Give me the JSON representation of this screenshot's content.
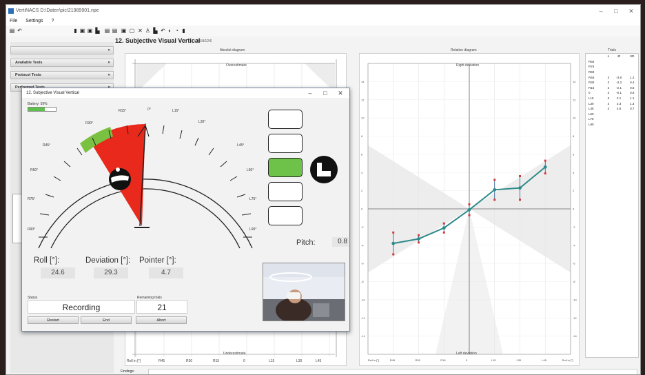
{
  "app": {
    "title": "VertiNACS D:\\Daten\\pic\\21989901.npe",
    "window_controls": {
      "minimize": "–",
      "maximize": "□",
      "close": "✕"
    }
  },
  "menu": {
    "items": [
      "File",
      "Settings",
      "?"
    ]
  },
  "toolbar": {
    "icons": [
      "open-icon",
      "save-icon",
      "save-as-icon",
      "print-icon",
      "user-icon",
      "copy-icon",
      "document-icon",
      "settings-icon",
      "tools-icon",
      "chart-icon",
      "undo-icon",
      "info-icon",
      "help-icon",
      "exit-icon"
    ]
  },
  "sidebar": {
    "items": [
      {
        "label": ""
      },
      {
        "label": "Available Tests"
      },
      {
        "label": "Protocol Tests"
      },
      {
        "label": "Performed Tests"
      }
    ]
  },
  "page": {
    "title": "12. Subjective Visual Vertical",
    "date": "2018/12/6"
  },
  "absolute_diagram": {
    "title": "Absolut diagram",
    "top_label": "Overestimate",
    "bottom_label": "Underestimate",
    "x_ticks": [
      "Roll in [°]",
      "R45",
      "R30",
      "R15",
      "0",
      "L15",
      "L30",
      "L45",
      "Roll in [°]"
    ]
  },
  "relative_diagram": {
    "title": "Relative diagram",
    "top_label": "Right deviation",
    "bottom_label": "Left deviation",
    "x_ticks": [
      "Roll in [°]",
      "R45",
      "R30",
      "R15",
      "0",
      "L15",
      "L30",
      "L45",
      "Roll in [°]"
    ],
    "y_ticks_left": [
      "15",
      "15",
      "14",
      "12",
      "10",
      "8",
      "6",
      "4",
      "2",
      "0",
      "-2",
      "-4",
      "-6",
      "-8",
      "-10",
      "-12",
      "-14",
      "-15"
    ]
  },
  "chart_data": {
    "type": "line",
    "title": "Relative diagram",
    "xlabel": "Roll in [°]",
    "ylabel": "",
    "categories": [
      "R45",
      "R30",
      "R15",
      "0",
      "L15",
      "L30",
      "L45"
    ],
    "x": [
      -45,
      -30,
      -15,
      0,
      15,
      30,
      45
    ],
    "xlim": [
      -60,
      60
    ],
    "ylim": [
      -16,
      16
    ],
    "series": [
      {
        "values": [
          -3.8,
          -3.3,
          -2.1,
          -0.1,
          2.1,
          2.3,
          4.6
        ],
        "sd": [
          1.2,
          0.4,
          0.5,
          0.6,
          1.1,
          1.3,
          0.7
        ]
      }
    ],
    "color": "#2e8a8a",
    "grid": true
  },
  "trials_table": {
    "title": "Trials",
    "headers": [
      "",
      "n",
      "Ø",
      "SD"
    ],
    "rows": [
      [
        "R60",
        "",
        "",
        ""
      ],
      [
        "R75",
        "",
        "",
        ""
      ],
      [
        "R60",
        "",
        "",
        ""
      ],
      [
        "R45",
        "3",
        "-3.8",
        "1.2"
      ],
      [
        "R30",
        "3",
        "-3.3",
        "0.4"
      ],
      [
        "R15",
        "3",
        "-2.1",
        "0.5"
      ],
      [
        "0",
        "3",
        "-0.1",
        "0.6"
      ],
      [
        "L15",
        "3",
        "2.1",
        "1.1"
      ],
      [
        "L30",
        "3",
        "2.3",
        "1.3"
      ],
      [
        "L45",
        "3",
        "4.6",
        "0.7"
      ],
      [
        "L60",
        "",
        "",
        ""
      ],
      [
        "L75",
        "",
        "",
        ""
      ],
      [
        "L90",
        "",
        "",
        ""
      ]
    ]
  },
  "findings": {
    "label": "Findings:"
  },
  "dialog": {
    "title": "12. Subjective Visual Vertical",
    "battery_label": "Battery: 59%",
    "battery_level": 0.59,
    "dial_labels": [
      "R45°",
      "R30°",
      "R15°",
      "0°",
      "L15°",
      "L30°",
      "L45°",
      "R60°",
      "R75°",
      "L60°",
      "L75°",
      "R90°",
      "L90°"
    ],
    "pitch_label": "Pitch:",
    "pitch_value": "0.8",
    "roll_label": "Roll [°]:",
    "roll_value": "24.6",
    "deviation_label": "Deviation [°]:",
    "deviation_value": "29.3",
    "pointer_label": "Pointer [°]:",
    "pointer_value": "4.7",
    "status_label": "Status",
    "status_value": "Recording",
    "remaining_label": "Remaining trials",
    "remaining_value": "21",
    "buttons": {
      "restart": "Restart",
      "end": "End",
      "abort": "Abort"
    }
  },
  "colors": {
    "accent": "#6ec24a",
    "deviation": "#e8291c",
    "line": "#2e8a8a"
  }
}
